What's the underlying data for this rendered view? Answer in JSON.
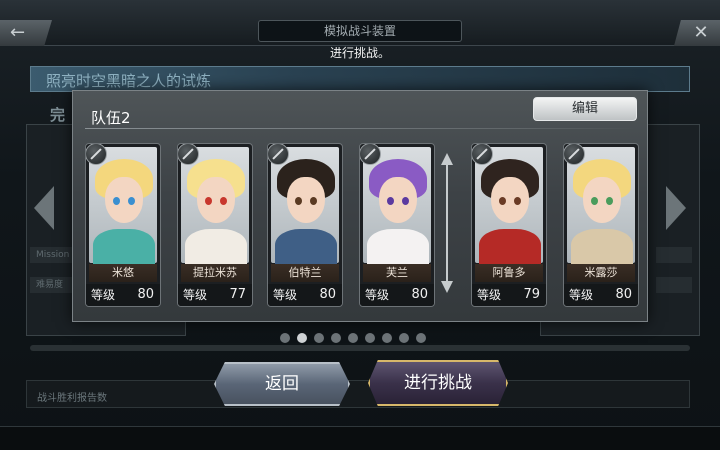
{
  "header": {
    "title": "模拟战斗装置",
    "subtitle": "进行挑战。"
  },
  "background": {
    "stage_title": "照亮时空黑暗之人的试炼",
    "left_label": "完",
    "strip_labels": [
      "Mission",
      "难易度"
    ],
    "battle_info": "战斗胜利报告数"
  },
  "modal": {
    "team_name": "队伍2",
    "edit_label": "编辑",
    "level_label": "等级",
    "characters": [
      {
        "name": "米悠",
        "level": "80",
        "hair": "#f4d77d",
        "eye": "#3a8fd0",
        "outfit": "#4ab0a6"
      },
      {
        "name": "提拉米苏",
        "level": "77",
        "hair": "#f6e08e",
        "eye": "#c8372d",
        "outfit": "#f1ece4"
      },
      {
        "name": "伯特兰",
        "level": "80",
        "hair": "#2b221c",
        "eye": "#5a3a22",
        "outfit": "#3f5f86"
      },
      {
        "name": "芙兰",
        "level": "80",
        "hair": "#8a5bc4",
        "eye": "#5b3aa0",
        "outfit": "#f4f2f2"
      },
      {
        "name": "阿鲁多",
        "level": "79",
        "hair": "#2f241f",
        "eye": "#6a3b25",
        "outfit": "#b52a26"
      },
      {
        "name": "米露莎",
        "level": "80",
        "hair": "#f3d77e",
        "eye": "#4a9c5c",
        "outfit": "#d9c8a8"
      }
    ]
  },
  "pagination": {
    "count": 9,
    "active": 1
  },
  "buttons": {
    "back_label": "返回",
    "challenge_label": "进行挑战"
  },
  "colors": {
    "panel": "#3d4246",
    "challenge_border": "#d7b86a",
    "back_button": "#5a6677"
  }
}
